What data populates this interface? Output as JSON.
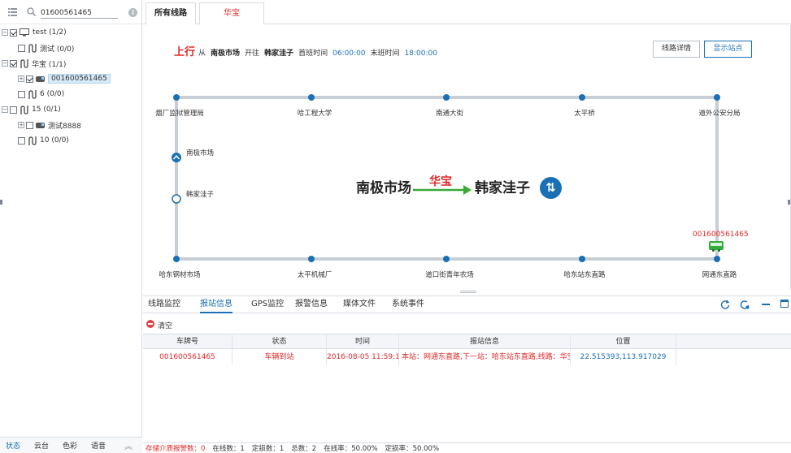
{
  "search": {
    "value": "01600561465"
  },
  "tree": {
    "nodes": [
      {
        "label": "test (1/2)"
      },
      {
        "label": "测试 (0/0)"
      },
      {
        "label": "华宝 (1/1)"
      },
      {
        "label": "001600561465"
      },
      {
        "label": "6 (0/0)"
      },
      {
        "label": "15 (0/1)"
      },
      {
        "label": "测试8888"
      },
      {
        "label": "10 (0/0)"
      }
    ]
  },
  "left_tabs": [
    "状态",
    "云台",
    "色彩",
    "语音"
  ],
  "top_tabs": {
    "all_routes": "所有线路",
    "route": "华宝"
  },
  "route_info": {
    "direction": "上行",
    "from_label": "从",
    "from": "南极市场",
    "to_label": "开往",
    "to": "韩家洼子",
    "first_label": "首班时间",
    "first_time": "06:00:00",
    "last_label": "末班时间",
    "last_time": "18:00:00"
  },
  "buttons": {
    "route_detail": "线路详情",
    "show_stations": "显示站点"
  },
  "stations": {
    "top": [
      "烟厂监狱管理局",
      "哈工程大学",
      "南通大街",
      "太平桥",
      "道外公安分局"
    ],
    "left": [
      "南极市场",
      "韩家洼子"
    ],
    "bottom": [
      "哈东钢材市场",
      "太平机械厂",
      "道口街青年农场",
      "哈东站东直路",
      "网通东直路"
    ]
  },
  "center_label": {
    "origin": "南极市场",
    "route": "华宝",
    "destination": "韩家洼子",
    "swap_icon": "swap-direction-icon"
  },
  "bus": {
    "plate": "001600561465",
    "icon": "bus-icon",
    "color": "#2fae3c"
  },
  "bottom_tabs": [
    "线路监控",
    "报站信息",
    "GPS监控",
    "报警信息",
    "媒体文件",
    "系统事件"
  ],
  "clear_label": "清空",
  "table": {
    "headers": [
      "车牌号",
      "状态",
      "时间",
      "报站信息",
      "位置"
    ],
    "rows": [
      [
        "001600561465",
        "车辆到站",
        "2016-08-05 11:59:15",
        "本站：网通东直路,下一站：哈东站东直路,线路：华宝(上行",
        "22.515393,113.917029"
      ]
    ]
  },
  "status_bar": [
    "存储介质报警数：0",
    "在线数：1",
    "定损数：1",
    "总数：2",
    "在线率：50.00%",
    "定损率：50.00%"
  ],
  "colors": {
    "accent": "#1a6fb5",
    "alert": "#e32929",
    "line": "#c8ced6"
  }
}
